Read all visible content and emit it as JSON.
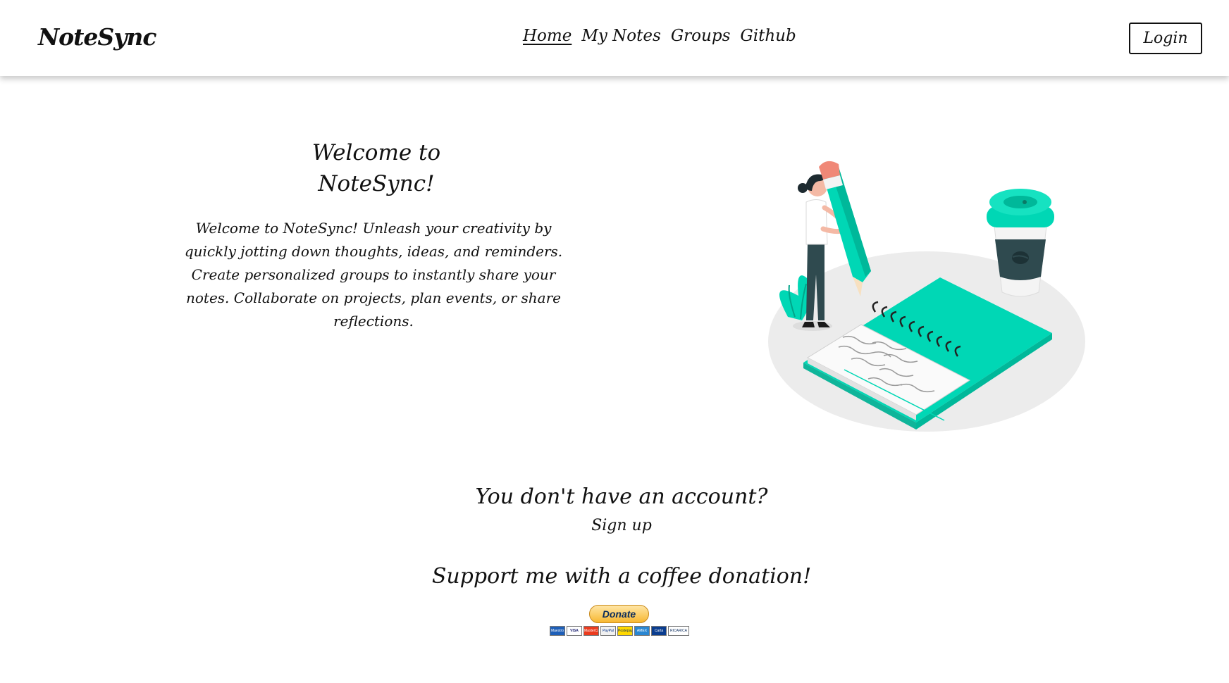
{
  "header": {
    "brand": "NoteSync",
    "nav": [
      "Home",
      "My Notes",
      "Groups",
      "Github"
    ],
    "active_nav": "Home",
    "login_label": "Login"
  },
  "hero": {
    "title_line1": "Welcome to",
    "title_line2": "NoteSync!",
    "description": "Welcome to NoteSync! Unleash your creativity by quickly jotting down thoughts, ideas, and reminders. Create personalized groups to instantly share your notes. Collaborate on projects, plan events, or share reflections."
  },
  "signup": {
    "question": "You don't have an account?",
    "link_label": "Sign up"
  },
  "donation": {
    "heading": "Support me with a coffee donation!",
    "button_label": "Donate",
    "card_labels": [
      "Maestro",
      "VISA",
      "MasterCard",
      "PayPal",
      "Postepay",
      "AMEX",
      "Carta",
      "RICARICA PAYPAL"
    ]
  },
  "colors": {
    "accent": "#00d7b5",
    "accent_dark": "#00b89a",
    "text": "#111111",
    "donate_gold": "#f7b731",
    "donate_text": "#0b2c5c",
    "shadow_ellipse": "#ececec"
  },
  "icons": {
    "illustration": "woman-writing-notebook-illustration",
    "coffee": "coffee-cup-icon"
  }
}
